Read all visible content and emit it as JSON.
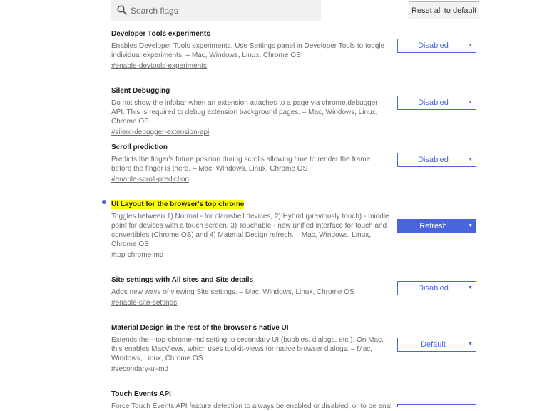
{
  "header": {
    "search_placeholder": "Search flags",
    "reset_label": "Reset all to default"
  },
  "flags": [
    {
      "title": "Developer Tools experiments",
      "desc": "Enables Developer Tools experiments. Use Settings panel in Developer Tools to toggle individual experiments. – Mac, Windows, Linux, Chrome OS",
      "link": "#enable-devtools-experiments",
      "value": "Disabled"
    },
    {
      "title": "Silent Debugging",
      "desc": "Do not show the infobar when an extension attaches to a page via chrome.debugger API. This is required to debug extension background pages. – Mac, Windows, Linux, Chrome OS",
      "link": "#silent-debugger-extension-api",
      "value": "Disabled"
    },
    {
      "title": "Scroll prediction",
      "desc": "Predicts the finger's future position during scrolls allowing time to render the frame before the finger is there. – Mac, Windows, Linux, Chrome OS",
      "link": "#enable-scroll-prediction",
      "value": "Disabled"
    },
    {
      "title": "UI Layout for the browser's top chrome",
      "desc": "Toggles between 1) Normal - for clamshell devices, 2) Hybrid (previously touch) - middle point for devices with a touch screen, 3) Touchable - new unified interface for touch and convertibles (Chrome OS) and 4) Material Design refresh. – Mac, Windows, Linux, Chrome OS",
      "link": "#top-chrome-md",
      "value": "Refresh"
    },
    {
      "title": "Site settings with All sites and Site details",
      "desc": "Adds new ways of viewing Site settings. – Mac, Windows, Linux, Chrome OS",
      "link": "#enable-site-settings",
      "value": "Disabled"
    },
    {
      "title": "Material Design in the rest of the browser's native UI",
      "desc": "Extends the --top-chrome-md setting to secondary UI (bubbles, dialogs, etc.). On Mac, this enables MacViews, which uses toolkit-views for native browser dialogs. – Mac, Windows, Linux, Chrome OS",
      "link": "#secondary-ui-md",
      "value": "Default"
    },
    {
      "title": "Touch Events API",
      "desc": "Force Touch Events API feature detection to always be enabled or disabled, or to be enabled",
      "link": "",
      "value": ""
    }
  ],
  "colors": {
    "accent": "#4a64dd",
    "highlight": "#ffff00"
  }
}
